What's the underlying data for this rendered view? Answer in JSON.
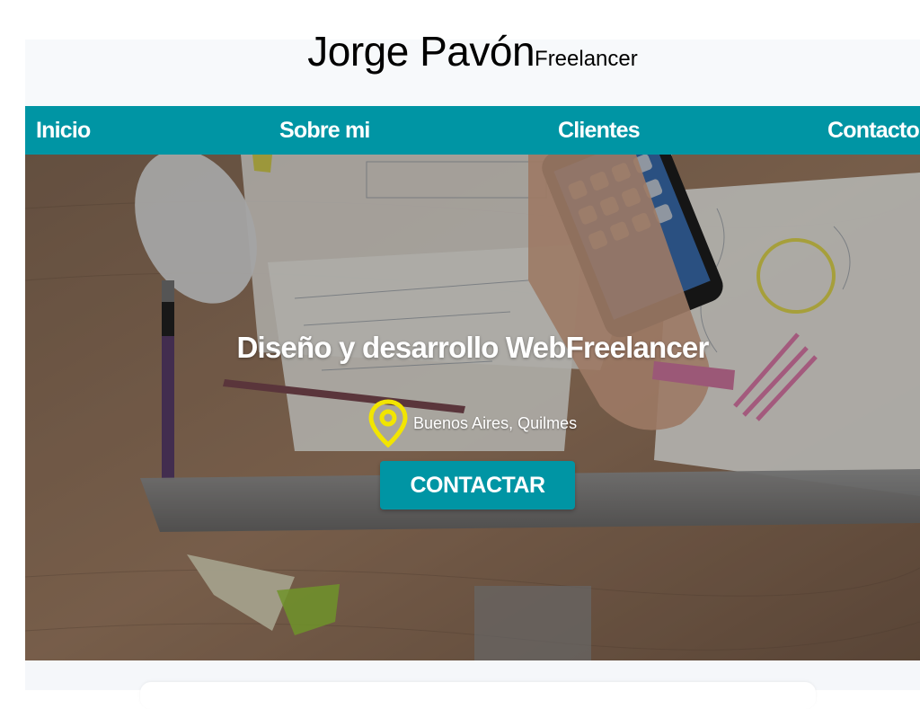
{
  "header": {
    "name": "Jorge Pavón",
    "role": "Freelancer"
  },
  "nav": {
    "items": [
      {
        "label": "Inicio"
      },
      {
        "label": "Sobre mi"
      },
      {
        "label": "Clientes"
      },
      {
        "label": "Contacto"
      }
    ]
  },
  "hero": {
    "title": "Diseño y desarrollo WebFreelancer",
    "location": "Buenos Aires, Quilmes",
    "location_icon": "location-pin-icon",
    "cta_label": "CONTACTAR"
  },
  "colors": {
    "accent": "#0095a4",
    "pin": "#f2e500",
    "text_light": "#ffffff"
  }
}
